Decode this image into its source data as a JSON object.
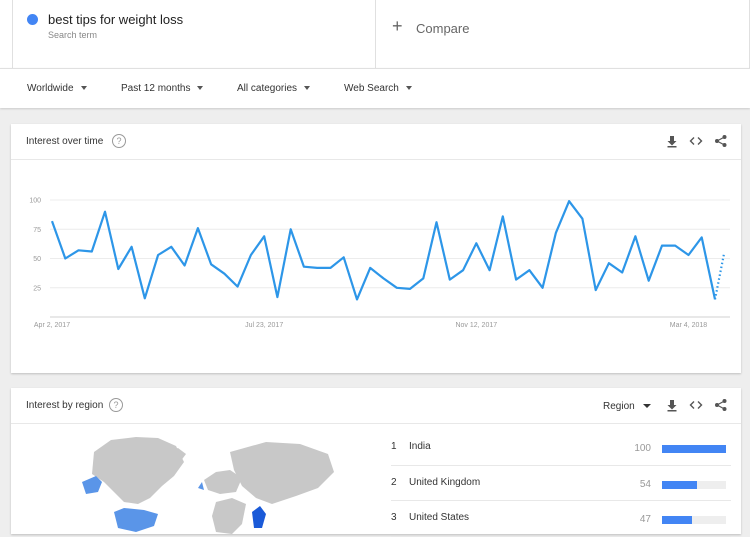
{
  "search": {
    "term": "best tips for weight loss",
    "term_sub": "Search term",
    "term_color": "#4285f4",
    "compare_label": "Compare"
  },
  "filters": [
    {
      "label": "Worldwide"
    },
    {
      "label": "Past 12 months"
    },
    {
      "label": "All categories"
    },
    {
      "label": "Web Search"
    }
  ],
  "interest_over_time": {
    "title": "Interest over time",
    "icons": [
      "download-icon",
      "embed-icon",
      "share-icon"
    ]
  },
  "interest_by_region": {
    "title": "Interest by region",
    "select_label": "Region",
    "icons": [
      "download-icon",
      "embed-icon",
      "share-icon"
    ],
    "rows": [
      {
        "rank": "1",
        "name": "India",
        "value": 100
      },
      {
        "rank": "2",
        "name": "United Kingdom",
        "value": 54
      },
      {
        "rank": "3",
        "name": "United States",
        "value": 47
      }
    ]
  },
  "chart_data": {
    "type": "line",
    "title": "",
    "xlabel": "",
    "ylabel": "",
    "ylim": [
      0,
      100
    ],
    "yticks": [
      25,
      50,
      75,
      100
    ],
    "xtick_labels": [
      "Apr 2, 2017",
      "Jul 23, 2017",
      "Nov 12, 2017",
      "Mar 4, 2018"
    ],
    "grid": true,
    "color": "#2d96e8",
    "series": [
      {
        "values": [
          82,
          50,
          57,
          56,
          90,
          41,
          60,
          16,
          53,
          60,
          44,
          76,
          45,
          37,
          26,
          53,
          69,
          17,
          75,
          43,
          42,
          42,
          51,
          15,
          42,
          33,
          25,
          24,
          33,
          81,
          32,
          40,
          63,
          40,
          86,
          32,
          40,
          25,
          72,
          99,
          84,
          23,
          46,
          38,
          69,
          31,
          61,
          61,
          53,
          68,
          15
        ],
        "partial_last": 54
      }
    ]
  }
}
